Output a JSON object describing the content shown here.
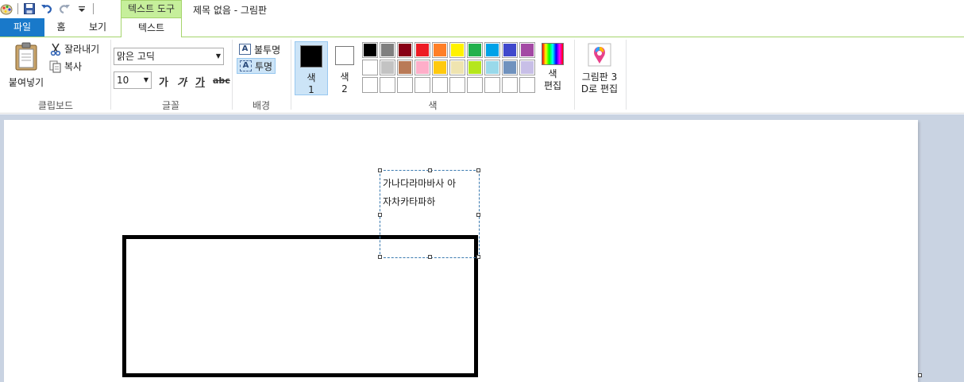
{
  "title_bar": {
    "context_tab": "텍스트 도구",
    "window_title": "제목 없음 - 그림판"
  },
  "tabs": {
    "file": "파일",
    "home": "홈",
    "view": "보기",
    "text": "텍스트"
  },
  "clipboard": {
    "paste": "붙여넣기",
    "cut": "잘라내기",
    "copy": "복사",
    "group_label": "클립보드"
  },
  "font": {
    "family": "맑은 고딕",
    "size": "10",
    "bold": "가",
    "italic": "가",
    "underline": "가",
    "strike": "abc",
    "group_label": "글꼴"
  },
  "background": {
    "opaque": "불투명",
    "transparent": "투명",
    "group_label": "배경"
  },
  "colors": {
    "color1_line1": "색",
    "color1_line2": "1",
    "color2_line1": "색",
    "color2_line2": "2",
    "color1_value": "#000000",
    "color2_value": "#ffffff",
    "edit_line1": "색",
    "edit_line2": "편집",
    "group_label": "색",
    "palette_row1": [
      "#000000",
      "#7f7f7f",
      "#880015",
      "#ed1c24",
      "#ff7f27",
      "#fff200",
      "#22b14c",
      "#00a2e8",
      "#3f48cc",
      "#a349a4"
    ],
    "palette_row2": [
      "#ffffff",
      "#c3c3c3",
      "#b97a57",
      "#ffaec9",
      "#ffc90e",
      "#efe4b0",
      "#b5e61d",
      "#99d9ea",
      "#7092be",
      "#c8bfe7"
    ],
    "palette_row3": [
      "#ffffff",
      "#ffffff",
      "#ffffff",
      "#ffffff",
      "#ffffff",
      "#ffffff",
      "#ffffff",
      "#ffffff",
      "#ffffff",
      "#ffffff"
    ]
  },
  "paint3d": {
    "line1": "그림판 3",
    "line2": "D로 편집"
  },
  "canvas": {
    "text_line1": "가나다라마바사 아",
    "text_line2": "자차카타파하"
  }
}
